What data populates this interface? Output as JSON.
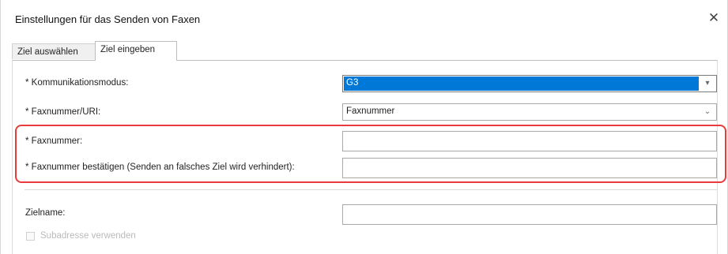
{
  "dialog": {
    "title": "Einstellungen für das Senden von Faxen",
    "close_glyph": "✕"
  },
  "tabs": [
    {
      "label": "Ziel auswählen",
      "active": false
    },
    {
      "label": "Ziel eingeben",
      "active": true
    }
  ],
  "form": {
    "comm_mode": {
      "label": "* Kommunikationsmodus:",
      "value": "G3",
      "chevron": "▾"
    },
    "fax_uri": {
      "label": "* Faxnummer/URI:",
      "value": "Faxnummer",
      "chevron": "⌄"
    },
    "fax_number": {
      "label": "* Faxnummer:",
      "value": ""
    },
    "fax_confirm": {
      "label": "* Faxnummer bestätigen (Senden an falsches Ziel wird verhindert):",
      "value": ""
    },
    "dest_name": {
      "label": "Zielname:",
      "value": ""
    },
    "subaddress": {
      "label": "Subadresse verwenden",
      "checked": false,
      "disabled": true
    }
  },
  "colors": {
    "highlight_border": "#e83b3b",
    "selection": "#0078d7"
  }
}
